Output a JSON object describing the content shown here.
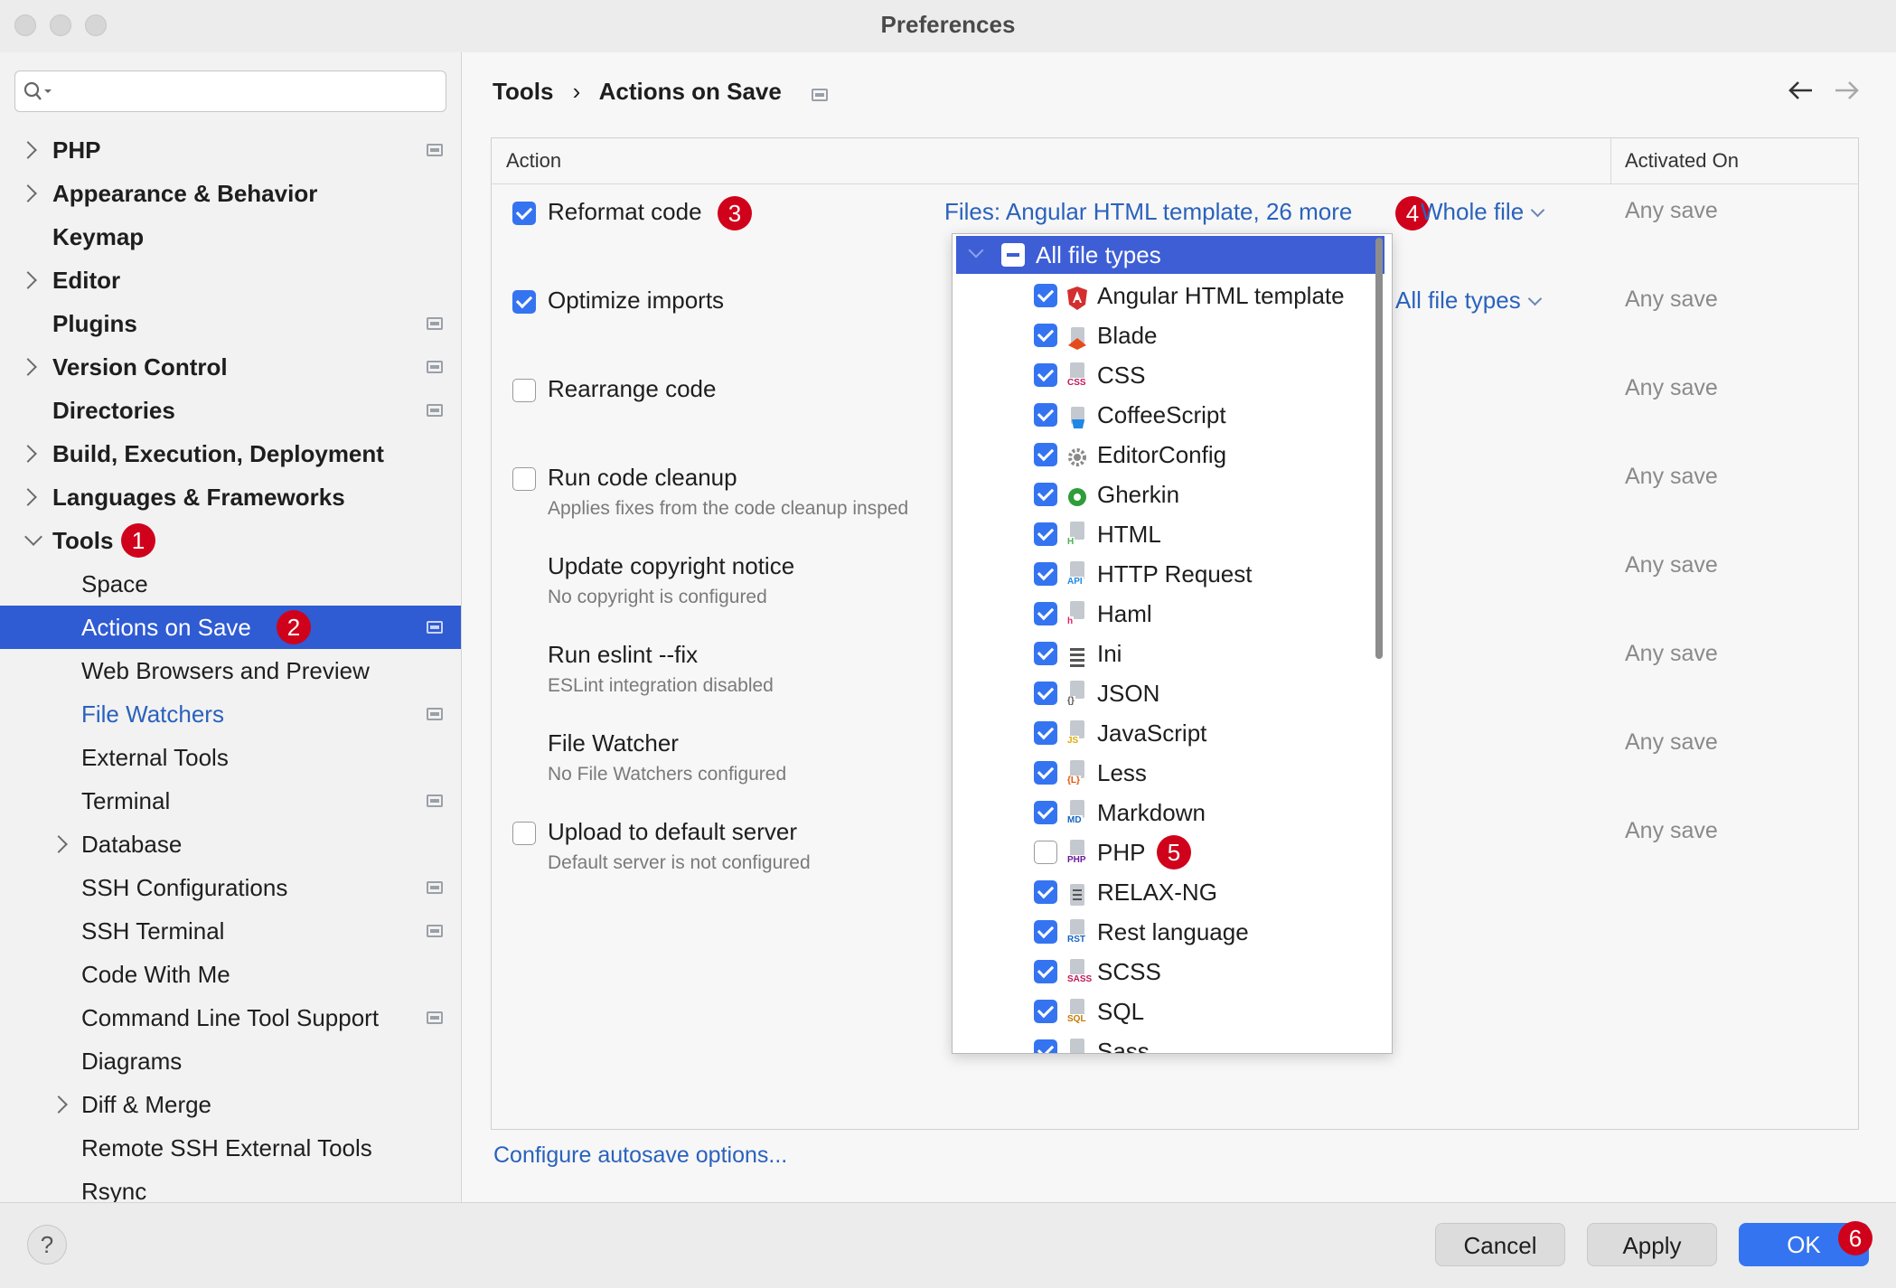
{
  "window": {
    "title": "Preferences"
  },
  "sidebar": {
    "search_placeholder": "",
    "items": [
      {
        "label": "PHP"
      },
      {
        "label": "Appearance & Behavior"
      },
      {
        "label": "Keymap"
      },
      {
        "label": "Editor"
      },
      {
        "label": "Plugins"
      },
      {
        "label": "Version Control"
      },
      {
        "label": "Directories"
      },
      {
        "label": "Build, Execution, Deployment"
      },
      {
        "label": "Languages & Frameworks"
      },
      {
        "label": "Tools",
        "badge": "1"
      },
      {
        "label": "Space"
      },
      {
        "label": "Actions on Save",
        "badge": "2"
      },
      {
        "label": "Web Browsers and Preview"
      },
      {
        "label": "File Watchers"
      },
      {
        "label": "External Tools"
      },
      {
        "label": "Terminal"
      },
      {
        "label": "Database"
      },
      {
        "label": "SSH Configurations"
      },
      {
        "label": "SSH Terminal"
      },
      {
        "label": "Code With Me"
      },
      {
        "label": "Command Line Tool Support"
      },
      {
        "label": "Diagrams"
      },
      {
        "label": "Diff & Merge"
      },
      {
        "label": "Remote SSH External Tools"
      },
      {
        "label": "Rsync"
      }
    ]
  },
  "breadcrumb": {
    "parent": "Tools",
    "separator": "›",
    "current": "Actions on Save"
  },
  "table": {
    "col_action": "Action",
    "col_activated": "Activated On",
    "rows": [
      {
        "label": "Reformat code",
        "checked": true,
        "badge": "3",
        "files_link": "Files: Angular HTML template, 26 more",
        "files_badge": "4",
        "scope": "Whole file",
        "activated": "Any save"
      },
      {
        "label": "Optimize imports",
        "checked": true,
        "scope": "All file types",
        "activated": "Any save"
      },
      {
        "label": "Rearrange code",
        "checked": false,
        "activated": "Any save"
      },
      {
        "label": "Run code cleanup",
        "checked": false,
        "desc": "Applies fixes from the code cleanup insped",
        "activated": "Any save"
      },
      {
        "label": "Update copyright notice",
        "desc": "No copyright is configured",
        "activated": "Any save"
      },
      {
        "label": "Run eslint --fix",
        "desc": "ESLint integration disabled",
        "activated": "Any save"
      },
      {
        "label": "File Watcher",
        "desc": "No File Watchers configured",
        "activated": "Any save"
      },
      {
        "label": "Upload to default server",
        "checked": false,
        "desc": "Default server is not configured",
        "activated": "Any save"
      }
    ]
  },
  "dropdown": {
    "header": "All file types",
    "items": [
      {
        "label": "Angular HTML template",
        "checked": true,
        "icon": "angular-icon"
      },
      {
        "label": "Blade",
        "checked": true,
        "icon": "blade-icon"
      },
      {
        "label": "CSS",
        "checked": true,
        "icon": "css-file-icon",
        "tag": "CSS"
      },
      {
        "label": "CoffeeScript",
        "checked": true,
        "icon": "coffeescript-icon"
      },
      {
        "label": "EditorConfig",
        "checked": true,
        "icon": "gear-icon"
      },
      {
        "label": "Gherkin",
        "checked": true,
        "icon": "gherkin-icon"
      },
      {
        "label": "HTML",
        "checked": true,
        "icon": "html-file-icon",
        "tag": "H"
      },
      {
        "label": "HTTP Request",
        "checked": true,
        "icon": "api-file-icon",
        "tag": "API"
      },
      {
        "label": "Haml",
        "checked": true,
        "icon": "haml-file-icon",
        "tag": "h"
      },
      {
        "label": "Ini",
        "checked": true,
        "icon": "ini-file-icon"
      },
      {
        "label": "JSON",
        "checked": true,
        "icon": "json-file-icon",
        "tag": "{}"
      },
      {
        "label": "JavaScript",
        "checked": true,
        "icon": "javascript-file-icon",
        "tag": "JS"
      },
      {
        "label": "Less",
        "checked": true,
        "icon": "less-file-icon",
        "tag": "{L}"
      },
      {
        "label": "Markdown",
        "checked": true,
        "icon": "markdown-file-icon",
        "tag": "MD"
      },
      {
        "label": "PHP",
        "checked": false,
        "icon": "php-file-icon",
        "tag": "PHP",
        "badge": "5"
      },
      {
        "label": "RELAX-NG",
        "checked": true,
        "icon": "relaxng-file-icon"
      },
      {
        "label": "Rest language",
        "checked": true,
        "icon": "rst-file-icon",
        "tag": "RST"
      },
      {
        "label": "SCSS",
        "checked": true,
        "icon": "scss-file-icon",
        "tag": "SASS"
      },
      {
        "label": "SQL",
        "checked": true,
        "icon": "sql-file-icon",
        "tag": "SQL"
      },
      {
        "label": "Sass",
        "checked": true,
        "icon": "sass-file-icon"
      }
    ]
  },
  "footer_link": "Configure autosave options...",
  "buttons": {
    "help": "?",
    "cancel": "Cancel",
    "apply": "Apply",
    "ok": "OK",
    "ok_badge": "6"
  },
  "colors": {
    "accent": "#3574f0",
    "selection": "#2f5bd3",
    "badge": "#d0021b",
    "link": "#2a62bc"
  }
}
